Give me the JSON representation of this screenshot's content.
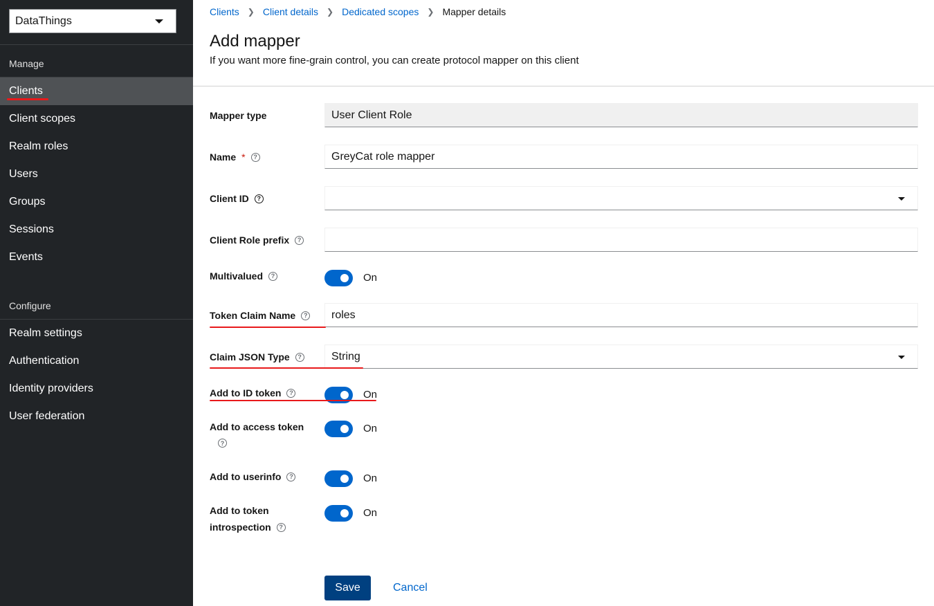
{
  "sidebar": {
    "realm": "DataThings",
    "manage_label": "Manage",
    "manage_items": [
      "Clients",
      "Client scopes",
      "Realm roles",
      "Users",
      "Groups",
      "Sessions",
      "Events"
    ],
    "configure_label": "Configure",
    "configure_items": [
      "Realm settings",
      "Authentication",
      "Identity providers",
      "User federation"
    ],
    "active_item": "Clients"
  },
  "breadcrumb": {
    "items": [
      "Clients",
      "Client details",
      "Dedicated scopes"
    ],
    "current": "Mapper details"
  },
  "page": {
    "title": "Add mapper",
    "description": "If you want more fine-grain control, you can create protocol mapper on this client"
  },
  "form": {
    "mapper_type_label": "Mapper type",
    "mapper_type_value": "User Client Role",
    "name_label": "Name",
    "name_required": "*",
    "name_value": "GreyCat role mapper",
    "client_id_label": "Client ID",
    "client_id_value": "",
    "client_role_prefix_label": "Client Role prefix",
    "client_role_prefix_value": "",
    "multivalued_label": "Multivalued",
    "multivalued_state": "On",
    "token_claim_name_label": "Token Claim Name",
    "token_claim_name_value": "roles",
    "claim_json_type_label": "Claim JSON Type",
    "claim_json_type_value": "String",
    "add_id_token_label": "Add to ID token",
    "add_id_token_state": "On",
    "add_access_token_label": "Add to access token",
    "add_access_token_state": "On",
    "add_userinfo_label": "Add to userinfo",
    "add_userinfo_state": "On",
    "add_introspection_label_1": "Add to token",
    "add_introspection_label_2": "introspection",
    "add_introspection_state": "On",
    "help_glyph": "?"
  },
  "actions": {
    "save": "Save",
    "cancel": "Cancel"
  },
  "colors": {
    "sidebar_bg": "#212427",
    "active_nav": "#4f5255",
    "link": "#0066cc",
    "primary_button": "#004080",
    "toggle_on": "#0066cc",
    "annotation": "#e8191b"
  }
}
